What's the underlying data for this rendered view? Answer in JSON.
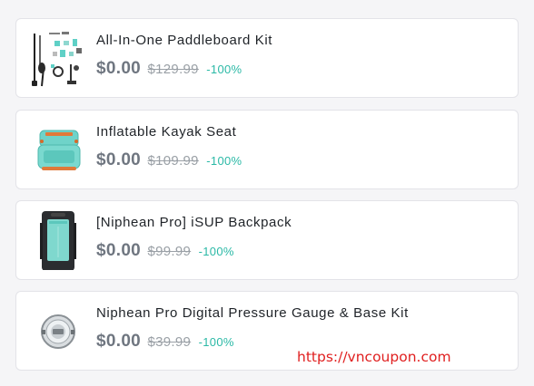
{
  "products": [
    {
      "title": "All-In-One Paddleboard Kit",
      "price": "$0.00",
      "old_price": "$129.99",
      "discount": "-100%",
      "image_icon": "paddleboard-kit-image"
    },
    {
      "title": "Inflatable Kayak Seat",
      "price": "$0.00",
      "old_price": "$109.99",
      "discount": "-100%",
      "image_icon": "kayak-seat-image"
    },
    {
      "title": "[Niphean Pro] iSUP Backpack",
      "price": "$0.00",
      "old_price": "$99.99",
      "discount": "-100%",
      "image_icon": "backpack-image"
    },
    {
      "title": "Niphean Pro Digital Pressure Gauge & Base Kit",
      "price": "$0.00",
      "old_price": "$39.99",
      "discount": "-100%",
      "image_icon": "pressure-gauge-image"
    }
  ],
  "watermark": "https://vncoupon.com",
  "colors": {
    "price": "#6f7680",
    "discount": "#2bb9a6",
    "watermark": "#e02020",
    "accent_teal": "#5fd0c6"
  }
}
